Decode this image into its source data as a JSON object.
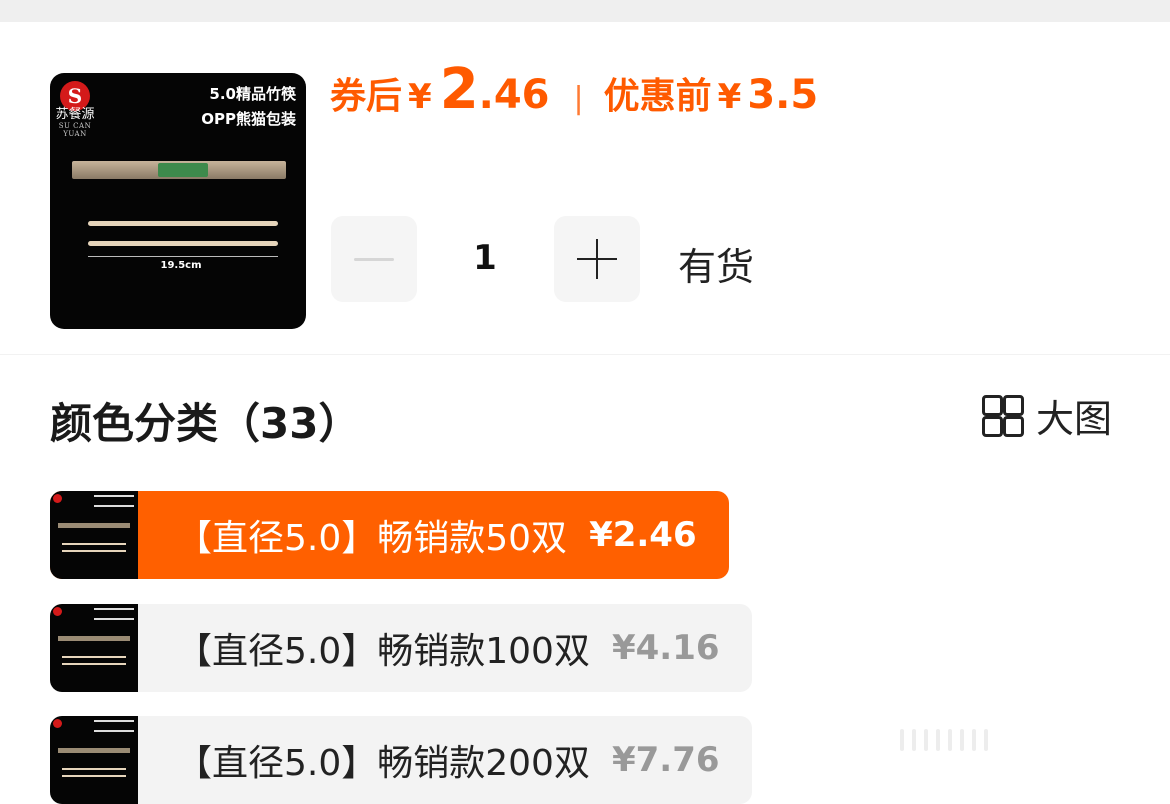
{
  "product": {
    "thumb_brand_cn": "苏餐源",
    "thumb_brand_en": "SU CAN YUAN",
    "thumb_title_line1": "5.0精品竹筷",
    "thumb_title_line2": "OPP熊猫包装",
    "thumb_size_label": "19.5cm"
  },
  "price": {
    "after_coupon_label": "券后",
    "currency": "¥",
    "after_coupon_int": "2",
    "after_coupon_dec": ".46",
    "separator": "|",
    "before_label": "优惠前",
    "before_value": "3.5",
    "accent_color": "#ff5a00"
  },
  "quantity": {
    "minus_icon": "minus-icon",
    "value": "1",
    "plus_icon": "plus-icon",
    "stock_label": "有货"
  },
  "section": {
    "title": "颜色分类（33）",
    "bigpic_label": "大图",
    "bigpic_icon": "grid-icon"
  },
  "options": [
    {
      "label": "【直径5.0】畅销款50双",
      "price": "¥2.46",
      "selected": true
    },
    {
      "label": "【直径5.0】畅销款100双",
      "price": "¥4.16",
      "selected": false
    },
    {
      "label": "【直径5.0】畅销款200双",
      "price": "¥7.76",
      "selected": false
    }
  ]
}
